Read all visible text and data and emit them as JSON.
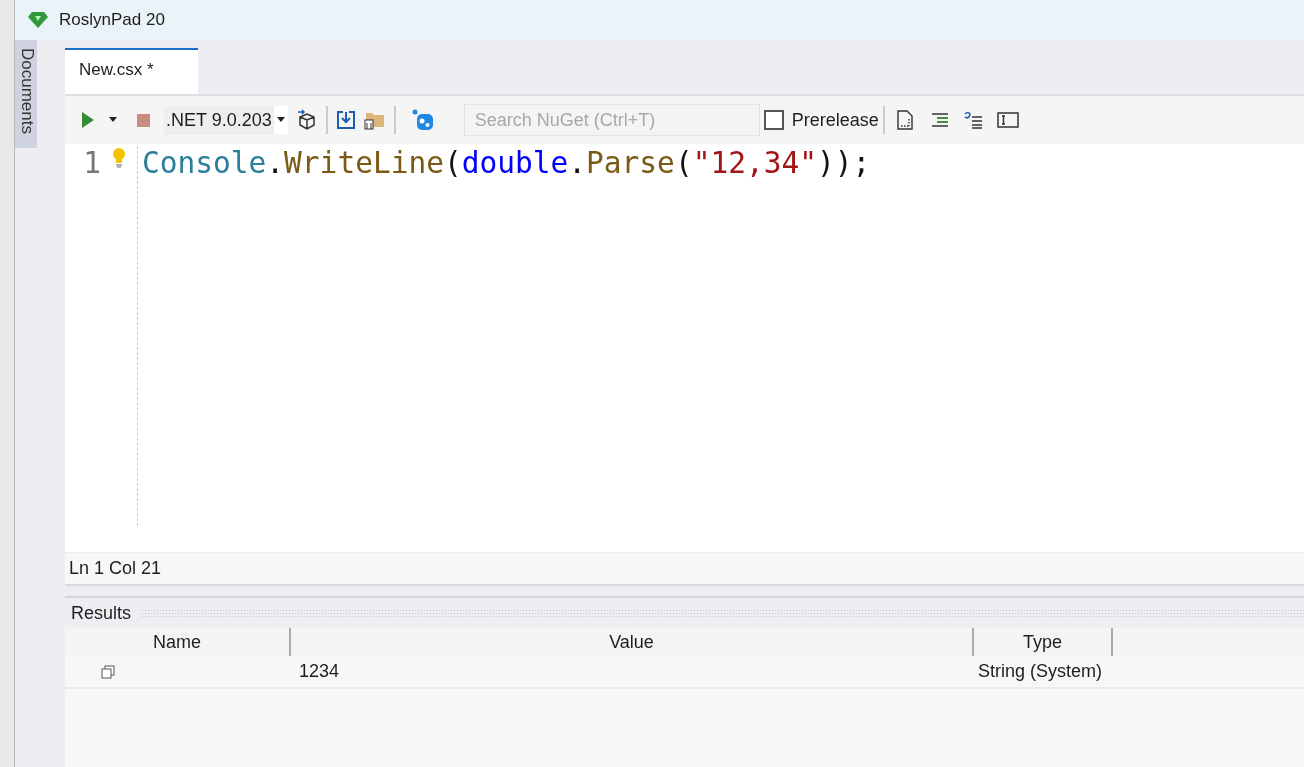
{
  "window": {
    "title": "RoslynPad 20"
  },
  "sidebar": {
    "label": "Documents"
  },
  "tabs": [
    {
      "label": "New.csx *",
      "selected": true
    }
  ],
  "toolbar": {
    "framework": ".NET 9.0.203",
    "search": {
      "placeholder": "Search NuGet (Ctrl+T)"
    },
    "prerelease": {
      "label": "Prerelease",
      "checked": false
    }
  },
  "editor": {
    "lines": [
      {
        "number": "1",
        "tokens": [
          {
            "kind": "type",
            "text": "Console"
          },
          {
            "kind": "punct",
            "text": "."
          },
          {
            "kind": "method",
            "text": "WriteLine"
          },
          {
            "kind": "punct",
            "text": "("
          },
          {
            "kind": "keyword",
            "text": "double"
          },
          {
            "kind": "punct",
            "text": "."
          },
          {
            "kind": "method",
            "text": "Parse"
          },
          {
            "kind": "punct",
            "text": "("
          },
          {
            "kind": "string",
            "text": "\"12,34\""
          },
          {
            "kind": "punct",
            "text": "));"
          }
        ]
      }
    ]
  },
  "status_bar": "Ln 1 Col 21",
  "results": {
    "title": "Results",
    "columns": [
      "Name",
      "Value",
      "Type"
    ],
    "rows": [
      {
        "value": "1234",
        "type": "String (System)"
      }
    ]
  }
}
